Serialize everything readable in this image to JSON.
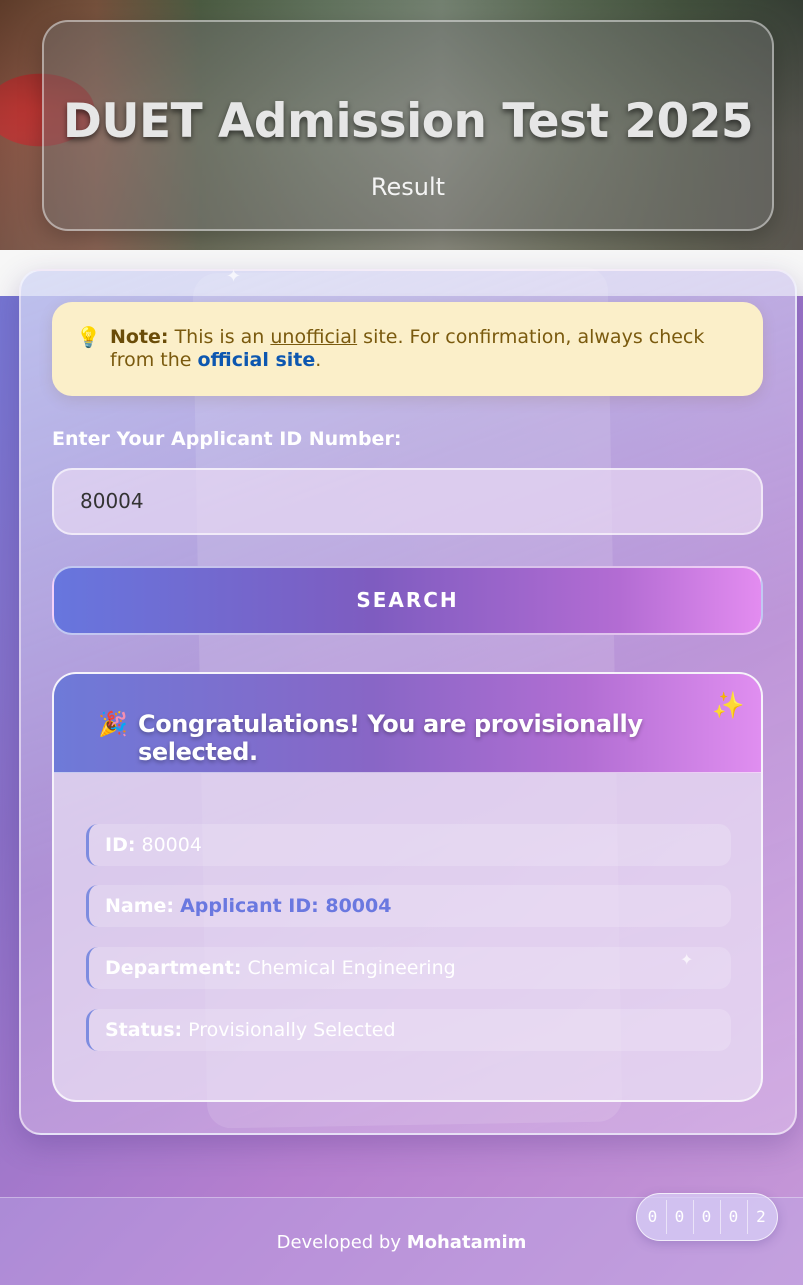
{
  "header": {
    "title": "DUET Admission Test 2025",
    "subtitle": "Result"
  },
  "note": {
    "icon": "lightbulb-icon",
    "label": "Note:",
    "text_before": " This is an ",
    "underlined": "unofficial",
    "text_middle": " site. For confirmation, always check from the ",
    "link": "official site",
    "text_end": "."
  },
  "form": {
    "label": "Enter Your Applicant ID Number:",
    "input_value": "80004",
    "search_label": "SEARCH"
  },
  "result": {
    "title": "Congratulations! You are provisionally selected.",
    "rows": [
      {
        "key": "ID:",
        "value": "80004"
      },
      {
        "key": "Name:",
        "value": "Applicant ID: 80004"
      },
      {
        "key": "Department:",
        "value": "Chemical Engineering"
      },
      {
        "key": "Status:",
        "value": "Provisionally Selected"
      }
    ]
  },
  "footer": {
    "prefix": "Developed by ",
    "author": "Mohatamim"
  },
  "counter": {
    "digits": [
      "0",
      "0",
      "0",
      "0",
      "2"
    ]
  },
  "colors": {
    "accent": "#6a78e0",
    "note_bg": "#fbefc9",
    "link": "#0d57b0"
  }
}
